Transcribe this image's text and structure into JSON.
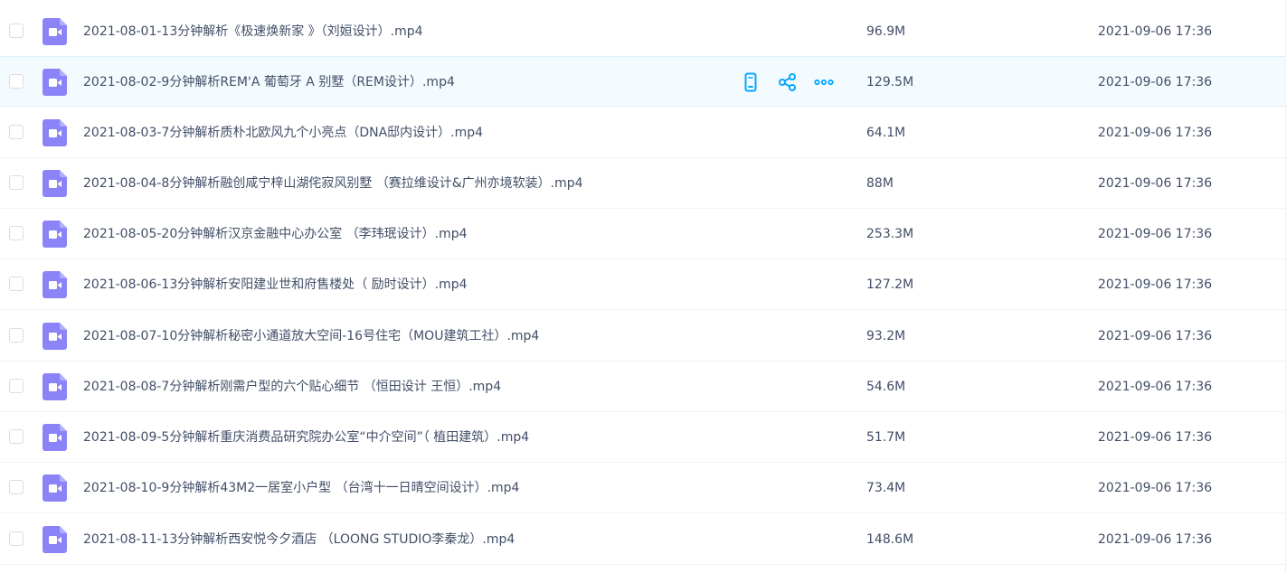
{
  "colors": {
    "accent": "#06a7ff",
    "icon_purple": "#8a84f8",
    "text": "#424e67",
    "row_hover": "#f4fbff"
  },
  "hover_actions": [
    "phone-icon",
    "share-icon",
    "more-icon"
  ],
  "files": [
    {
      "name": "2021-08-01-13分钟解析《极速焕新家 》（刘姮设计）.mp4",
      "size": "96.9M",
      "date": "2021-09-06 17:36",
      "icon": "video-file-icon"
    },
    {
      "name": "2021-08-02-9分钟解析REM'A 葡萄牙 A 别墅（REM设计）.mp4",
      "size": "129.5M",
      "date": "2021-09-06 17:36",
      "icon": "video-file-icon"
    },
    {
      "name": "2021-08-03-7分钟解析质朴北欧风九个小亮点（DNA邸内设计）.mp4",
      "size": "64.1M",
      "date": "2021-09-06 17:36",
      "icon": "video-file-icon"
    },
    {
      "name": "2021-08-04-8分钟解析融创咸宁梓山湖侘寂风别墅 （赛拉维设计&广州亦境软装）.mp4",
      "size": "88M",
      "date": "2021-09-06 17:36",
      "icon": "video-file-icon"
    },
    {
      "name": "2021-08-05-20分钟解析汉京金融中心办公室 （李玮珉设计）.mp4",
      "size": "253.3M",
      "date": "2021-09-06 17:36",
      "icon": "video-file-icon"
    },
    {
      "name": "2021-08-06-13分钟解析安阳建业世和府售楼处（ 励时设计）.mp4",
      "size": "127.2M",
      "date": "2021-09-06 17:36",
      "icon": "video-file-icon"
    },
    {
      "name": "2021-08-07-10分钟解析秘密小通道放大空间-16号住宅（MOU建筑工社）.mp4",
      "size": "93.2M",
      "date": "2021-09-06 17:36",
      "icon": "video-file-icon"
    },
    {
      "name": "2021-08-08-7分钟解析刚需户型的六个贴心细节 （恒田设计 王恒）.mp4",
      "size": "54.6M",
      "date": "2021-09-06 17:36",
      "icon": "video-file-icon"
    },
    {
      "name": "2021-08-09-5分钟解析重庆消费品研究院办公室“中介空间”（ 植田建筑）.mp4",
      "size": "51.7M",
      "date": "2021-09-06 17:36",
      "icon": "video-file-icon"
    },
    {
      "name": "2021-08-10-9分钟解析43M2一居室小户型 （台湾十一日晴空间设计）.mp4",
      "size": "73.4M",
      "date": "2021-09-06 17:36",
      "icon": "video-file-icon"
    },
    {
      "name": "2021-08-11-13分钟解析西安悦今夕酒店 （LOONG STUDIO李秦龙）.mp4",
      "size": "148.6M",
      "date": "2021-09-06 17:36",
      "icon": "video-file-icon"
    }
  ]
}
